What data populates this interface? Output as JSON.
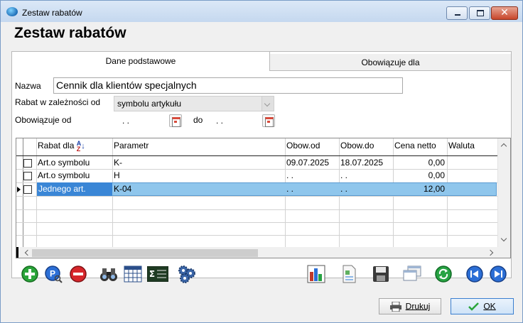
{
  "window": {
    "title": "Zestaw rabatów"
  },
  "header": {
    "title": "Zestaw rabatów"
  },
  "tabs": [
    {
      "label": "Dane podstawowe",
      "active": true
    },
    {
      "label": "Obowiązuje dla",
      "active": false
    }
  ],
  "form": {
    "name_label": "Nazwa",
    "name_value": "Cennik dla klientów specjalnych",
    "rebate_label": "Rabat w zależności od",
    "rebate_value": "symbolu artykułu",
    "valid_from_label": "Obowiązuje od",
    "valid_from_value": ". .",
    "valid_to_label": "do",
    "valid_to_value": ". ."
  },
  "grid": {
    "columns": [
      "Rabat dla",
      "Parametr",
      "Obow.od",
      "Obow.do",
      "Cena netto",
      "Waluta"
    ],
    "rows": [
      {
        "rabat_dla": "Art.o symbolu",
        "parametr": "K-",
        "obow_od": "09.07.2025",
        "obow_do": "18.07.2025",
        "cena_netto": "0,00",
        "waluta": "",
        "selected": false
      },
      {
        "rabat_dla": "Art.o symbolu",
        "parametr": "H",
        "obow_od": ". .",
        "obow_do": ". .",
        "cena_netto": "0,00",
        "waluta": "",
        "selected": false
      },
      {
        "rabat_dla": "Jednego art.",
        "parametr": "K-04",
        "obow_od": ". .",
        "obow_do": ". .",
        "cena_netto": "12,00",
        "waluta": "",
        "selected": true
      }
    ]
  },
  "toolbar": {
    "left_icons": [
      "add-icon",
      "search-edit-icon",
      "delete-icon",
      "binoculars-icon",
      "table-filter-icon",
      "sum-icon",
      "settings-icon"
    ],
    "right_icons": [
      "chart-icon",
      "document-icon",
      "save-icon",
      "windows-icon",
      "refresh-icon",
      "first-record-icon",
      "last-record-icon"
    ]
  },
  "buttons": {
    "print_label": "Drukuj",
    "ok_label": "OK"
  },
  "colors": {
    "selection": "#8fc6ec",
    "selection_focus": "#3a86d6",
    "add_green": "#2aa53a",
    "delete_red": "#d7262b",
    "nav_blue": "#2c6fd6"
  }
}
